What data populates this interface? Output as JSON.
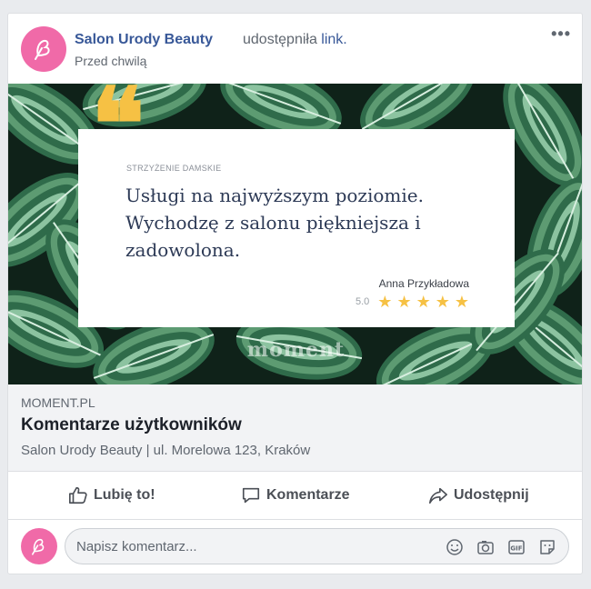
{
  "post": {
    "page_name": "Salon Urody Beauty",
    "shared_text": "udostępniła",
    "shared_link": "link.",
    "time": "Przed chwilą",
    "more": "•••"
  },
  "image": {
    "quote_mark": "❝",
    "category": "STRZYŻENIE DAMSKIE",
    "quote": "Usługi na najwyższym poziomie. Wychodzę z salonu piękniejsza i zadowolona.",
    "author": "Anna Przykładowa",
    "rating_value": "5.0",
    "rating": 5,
    "watermark": "moment"
  },
  "link": {
    "domain": "MOMENT.PL",
    "title": "Komentarze użytkowników",
    "description": "Salon Urody Beauty | ul. Morelowa 123, Kraków"
  },
  "actions": {
    "like": "Lubię to!",
    "comment": "Komentarze",
    "share": "Udostępnij"
  },
  "comment_input": {
    "placeholder": "Napisz komentarz..."
  },
  "icons": {
    "avatar": "brush-logo-icon",
    "like": "thumbs-up-icon",
    "comment": "speech-bubble-icon",
    "share": "share-arrow-icon",
    "emoji": "emoji-icon",
    "camera": "camera-icon",
    "gif": "gif-icon",
    "sticker": "sticker-icon"
  },
  "colors": {
    "brand_pink": "#f06aa8",
    "link_blue": "#385898",
    "star_yellow": "#f6c144",
    "leaf_green": "#2f6b4a"
  }
}
